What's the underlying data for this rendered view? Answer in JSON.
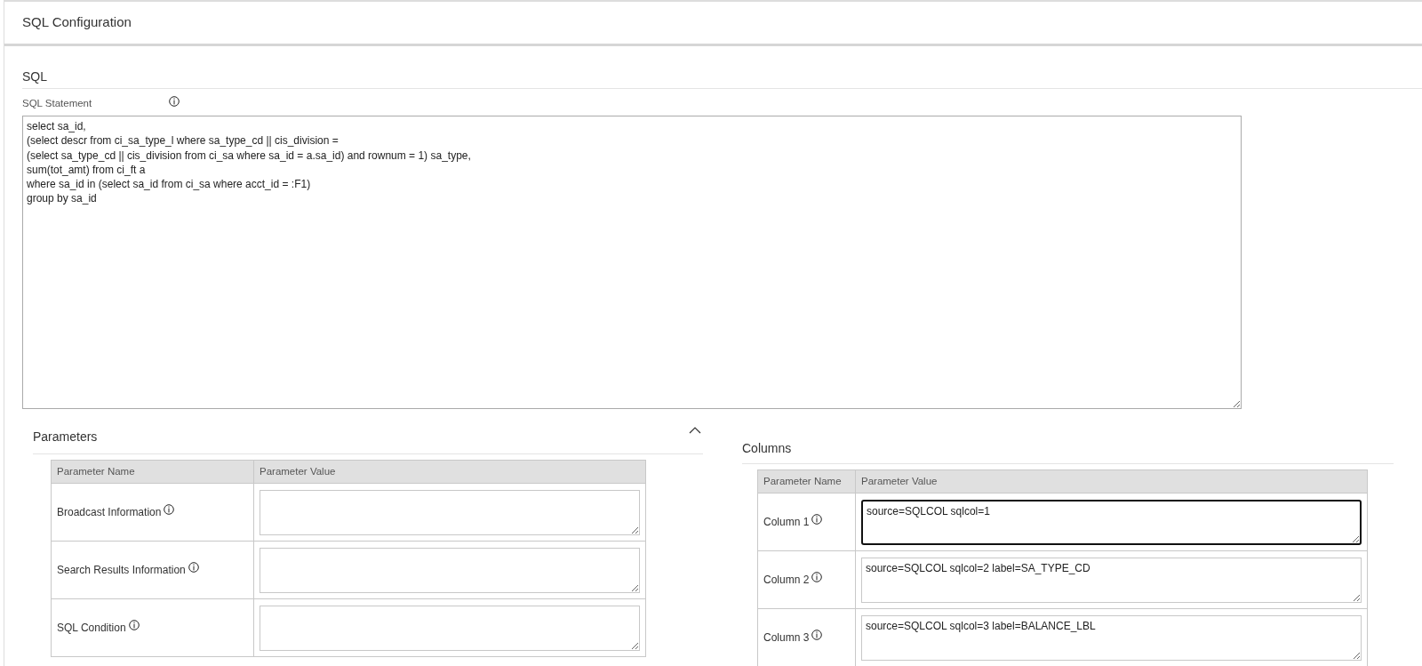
{
  "window": {
    "title": "SQL Configuration"
  },
  "sql": {
    "heading": "SQL",
    "statement_label": "SQL Statement",
    "statement": "select sa_id,\n(select descr from ci_sa_type_l where sa_type_cd || cis_division =\n(select sa_type_cd || cis_division from ci_sa where sa_id = a.sa_id) and rownum = 1) sa_type,\nsum(tot_amt) from ci_ft a\nwhere sa_id in (select sa_id from ci_sa where acct_id = :F1)\ngroup by sa_id"
  },
  "parameters": {
    "heading": "Parameters",
    "expanded": true,
    "columns": [
      "Parameter Name",
      "Parameter Value"
    ],
    "rows": [
      {
        "name": "Broadcast Information",
        "value": "",
        "focused": false
      },
      {
        "name": "Search Results Information",
        "value": "",
        "focused": false
      },
      {
        "name": "SQL Condition",
        "value": "",
        "focused": false
      }
    ]
  },
  "columns": {
    "heading": "Columns",
    "columns": [
      "Parameter Name",
      "Parameter Value"
    ],
    "rows": [
      {
        "name": "Column 1",
        "value": "source=SQLCOL sqlcol=1",
        "focused": true
      },
      {
        "name": "Column 2",
        "value": "source=SQLCOL sqlcol=2 label=SA_TYPE_CD",
        "focused": false
      },
      {
        "name": "Column 3",
        "value": "source=SQLCOL sqlcol=3 label=BALANCE_LBL",
        "focused": false
      }
    ]
  }
}
